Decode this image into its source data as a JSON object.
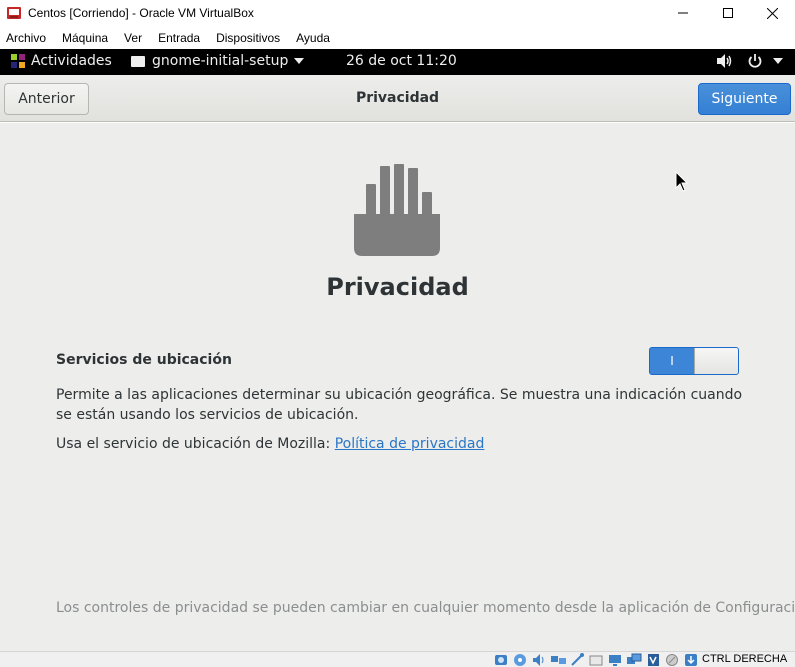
{
  "window": {
    "title": "Centos [Corriendo] - Oracle VM VirtualBox",
    "minimize": "—",
    "maximize": "☐",
    "close": "✕"
  },
  "menubar": {
    "items": [
      "Archivo",
      "Máquina",
      "Ver",
      "Entrada",
      "Dispositivos",
      "Ayuda"
    ]
  },
  "topbar": {
    "activities": "Actividades",
    "app_menu": "gnome-initial-setup",
    "clock": "26 de oct  11:20"
  },
  "header": {
    "back_label": "Anterior",
    "title": "Privacidad",
    "next_label": "Siguiente"
  },
  "content": {
    "heading": "Privacidad",
    "location_label": "Servicios de ubicación",
    "location_enabled": true,
    "toggle_on_mark": "I",
    "description": "Permite a las aplicaciones determinar su ubicación geográfica. Se muestra una indicación cuando se están usando los servicios de ubicación.",
    "mozilla_text": "Usa el servicio de ubicación de Mozilla: ",
    "mozilla_link": "Política de privacidad",
    "footer_note": "Los controles de privacidad se pueden cambiar en cualquier momento desde la aplicación de Configuración."
  },
  "statusbar": {
    "host_key": "CTRL DERECHA",
    "icons": [
      "hard-disk-icon",
      "optical-drive-icon",
      "audio-icon",
      "network-icon",
      "usb-icon",
      "shared-folders-icon",
      "display-icon",
      "video-capture-icon",
      "virtualization-icon",
      "mouse-integration-icon",
      "host-key-arrow-icon"
    ]
  },
  "colors": {
    "accent": "#3d85d6",
    "link": "#2a76c6",
    "background": "#ededec",
    "topbar": "#000000"
  }
}
